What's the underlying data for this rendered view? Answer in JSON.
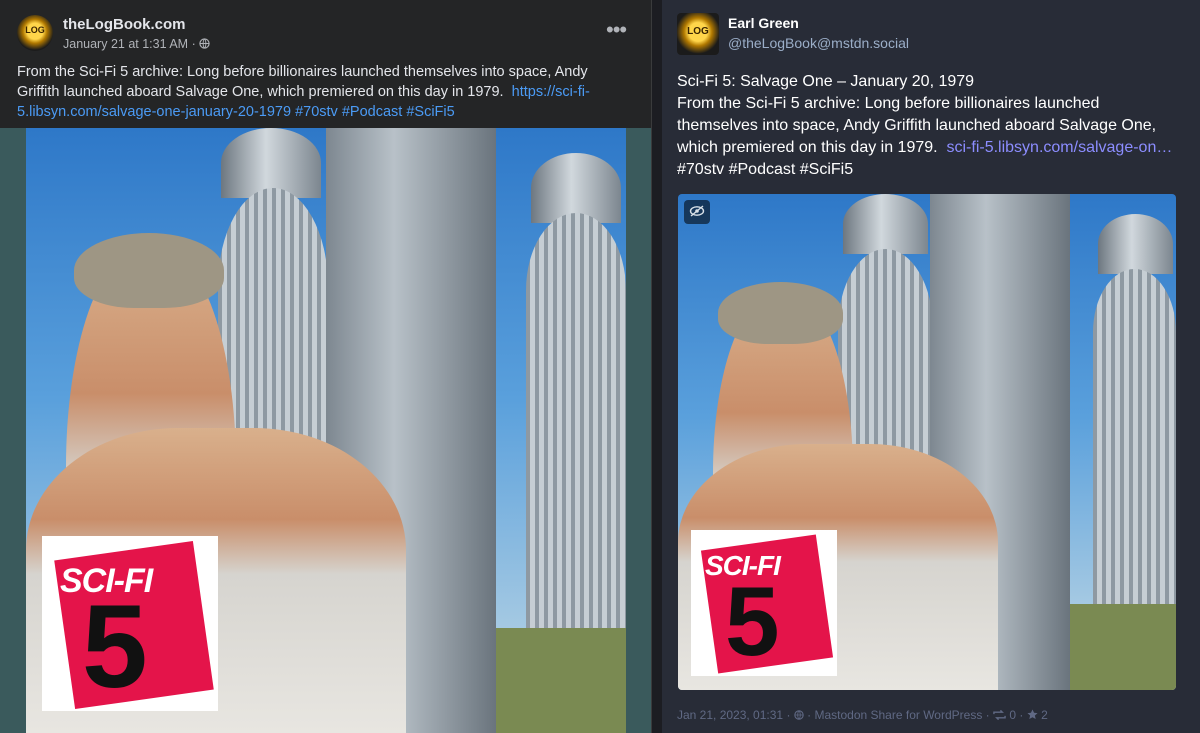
{
  "facebook": {
    "page_name": "theLogBook.com",
    "timestamp": "January 21 at 1:31 AM",
    "audience_separator": "·",
    "avatar_text": "LOG",
    "more_icon": "more-horizontal-icon",
    "post_text": "From the Sci-Fi 5 archive: Long before billionaires launched themselves into space, Andy Griffith launched aboard Salvage One, which premiered on this day in 1979.",
    "link_text": "https://sci-fi-5.libsyn.com/salvage-one-january-20-1979",
    "hashtags": [
      "#70stv",
      "#Podcast",
      "#SciFi5"
    ]
  },
  "mastodon": {
    "display_name": "Earl Green",
    "handle": "@theLogBook@mstdn.social",
    "avatar_text": "LOG",
    "title_line": "Sci-Fi 5: Salvage One – January 20, 1979",
    "post_text": "From the Sci-Fi 5 archive: Long before billionaires launched themselves into space, Andy Griffith launched aboard Salvage One, which premiered on this day in 1979.",
    "link_text": "sci-fi-5.libsyn.com/salvage-on…",
    "hashtags": [
      "#70stv",
      "#Podcast",
      "#SciFi5"
    ],
    "footer": {
      "date": "Jan 21, 2023, 01:31",
      "visibility_icon": "globe-icon",
      "app": "Mastodon Share for WordPress",
      "boost_count": "0",
      "fav_count": "2"
    }
  },
  "image": {
    "logo_word": "SCI-FI",
    "logo_number": "5"
  }
}
